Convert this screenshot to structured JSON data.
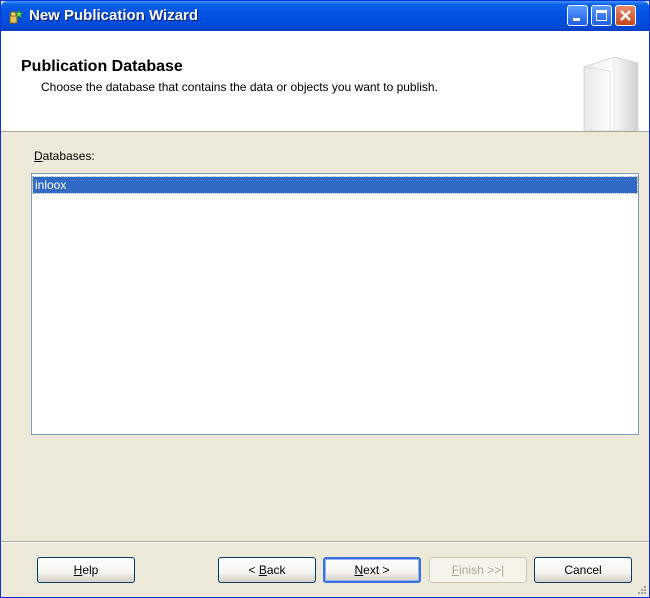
{
  "window": {
    "title": "New Publication Wizard"
  },
  "header": {
    "title": "Publication Database",
    "subtitle": "Choose the database that contains the data or objects you want to publish."
  },
  "databases": {
    "label_mnemonic": "D",
    "label_rest": "atabases:",
    "items": [
      {
        "name": "inloox",
        "selected": true
      }
    ]
  },
  "buttons": {
    "help": {
      "mnemonic": "H",
      "rest": "elp",
      "enabled": true
    },
    "back": {
      "prefix": "< ",
      "mnemonic": "B",
      "rest": "ack",
      "enabled": true
    },
    "next": {
      "mnemonic": "N",
      "rest": "ext >",
      "enabled": true,
      "default": true
    },
    "finish": {
      "mnemonic": "F",
      "rest": "inish >>|",
      "enabled": false
    },
    "cancel": {
      "label": "Cancel",
      "enabled": true
    }
  },
  "colors": {
    "titlebar": "#0054e3",
    "selection": "#316ac5",
    "dialog_bg": "#ece9d8"
  }
}
